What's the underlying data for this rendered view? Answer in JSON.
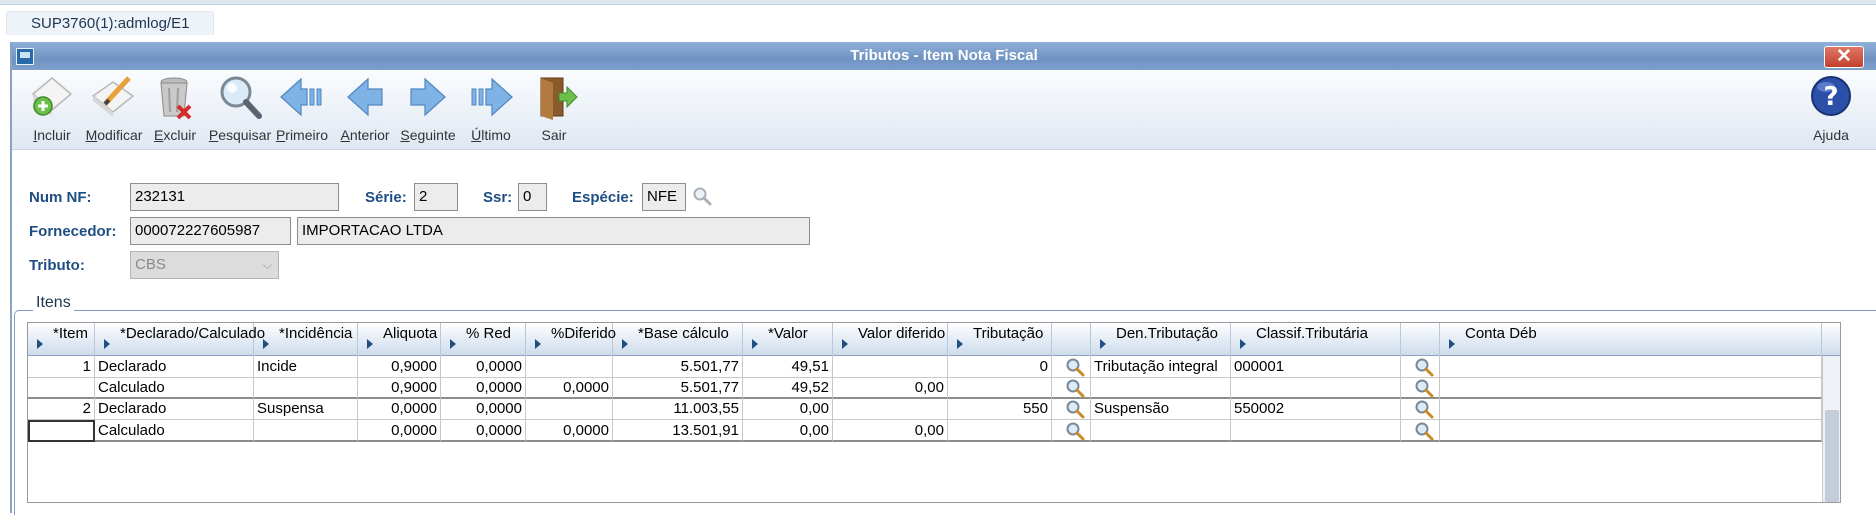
{
  "session": {
    "tab": "SUP3760(1):admlog/E1"
  },
  "window": {
    "title": "Tributos - Item Nota Fiscal",
    "close": "✕"
  },
  "toolbar": {
    "buttons": [
      {
        "pre": "",
        "u": "I",
        "post": "ncluir",
        "icon": "add-document-icon"
      },
      {
        "pre": "",
        "u": "M",
        "post": "odificar",
        "icon": "edit-document-icon"
      },
      {
        "pre": "",
        "u": "E",
        "post": "xcluir",
        "icon": "trash-icon"
      },
      {
        "pre": "",
        "u": "P",
        "post": "esquisar",
        "icon": "magnifier-icon"
      },
      {
        "pre": "",
        "u": "P",
        "post": "rimeiro",
        "icon": "first-arrow-icon"
      },
      {
        "pre": "",
        "u": "A",
        "post": "nterior",
        "icon": "previous-arrow-icon"
      },
      {
        "pre": "",
        "u": "S",
        "post": "eguinte",
        "icon": "next-arrow-icon"
      },
      {
        "pre": "",
        "u": "Ú",
        "post": "ltimo",
        "icon": "last-arrow-icon"
      },
      {
        "pre": "",
        "u": "",
        "post": "Sair",
        "icon": "exit-door-icon"
      }
    ],
    "help": {
      "label": "Ajuda",
      "icon": "help-icon"
    }
  },
  "form": {
    "num_nf_label": "Num NF:",
    "num_nf": "232131",
    "serie_label": "Série:",
    "serie": "2",
    "ssr_label": "Ssr:",
    "ssr": "0",
    "especie_label": "Espécie:",
    "especie": "NFE",
    "fornecedor_label": "Fornecedor:",
    "fornecedor_code": "000072227605987",
    "fornecedor_name": "IMPORTACAO LTDA",
    "tributo_label": "Tributo:",
    "tributo": "CBS"
  },
  "itens": {
    "label": "Itens",
    "columns": [
      "*Item",
      "*Declarado/Calculado",
      "*Incidência",
      "Aliquota",
      "% Red",
      "%Diferido",
      "*Base cálculo",
      "*Valor",
      "Valor diferido",
      "Tributação",
      "",
      "Den.Tributação",
      "Classif.Tributária",
      "",
      "Conta Déb"
    ],
    "rows": [
      [
        "1",
        "Declarado",
        "Incide",
        "0,9000",
        "0,0000",
        "",
        "5.501,77",
        "49,51",
        "",
        "0",
        "",
        "Tributação integral",
        "000001",
        "",
        ""
      ],
      [
        "",
        "Calculado",
        "",
        "0,9000",
        "0,0000",
        "0,0000",
        "5.501,77",
        "49,52",
        "0,00",
        "",
        "",
        "",
        "",
        "",
        ""
      ],
      [
        "2",
        "Declarado",
        "Suspensa",
        "0,0000",
        "0,0000",
        "",
        "11.003,55",
        "0,00",
        "",
        "550",
        "",
        "Suspensão",
        "550002",
        "",
        ""
      ],
      [
        "",
        "Calculado",
        "",
        "0,0000",
        "0,0000",
        "0,0000",
        "13.501,91",
        "0,00",
        "0,00",
        "",
        "",
        "",
        "",
        "",
        ""
      ]
    ]
  },
  "colors": {
    "title_bar": "#7d9fcc",
    "label_blue": "#1f4e84",
    "close_red": "#c2402d"
  }
}
